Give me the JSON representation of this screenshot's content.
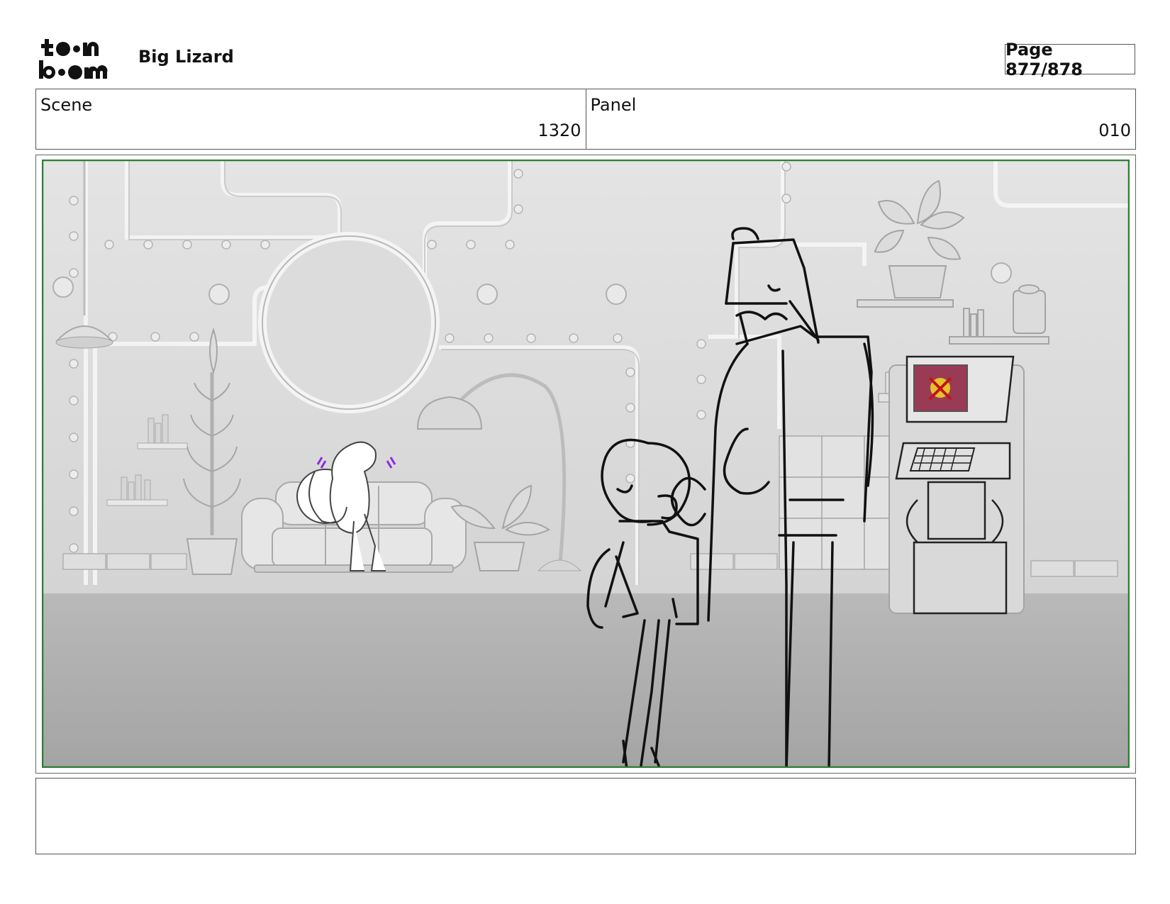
{
  "header": {
    "logo_text": "toon boom",
    "project_title": "Big Lizard",
    "page_label": "Page 877/878"
  },
  "info": {
    "scene_label": "Scene",
    "scene_value": "1320",
    "panel_label": "Panel",
    "panel_value": "010"
  },
  "panel": {
    "frame_color": "#2e7d32",
    "screen_color": "#9a3b55",
    "accent_purple": "#8a2be2",
    "icons": [
      "lamp-icon",
      "plant-icon",
      "sofa-icon",
      "computer-console-icon"
    ]
  },
  "notes": {
    "text": ""
  }
}
